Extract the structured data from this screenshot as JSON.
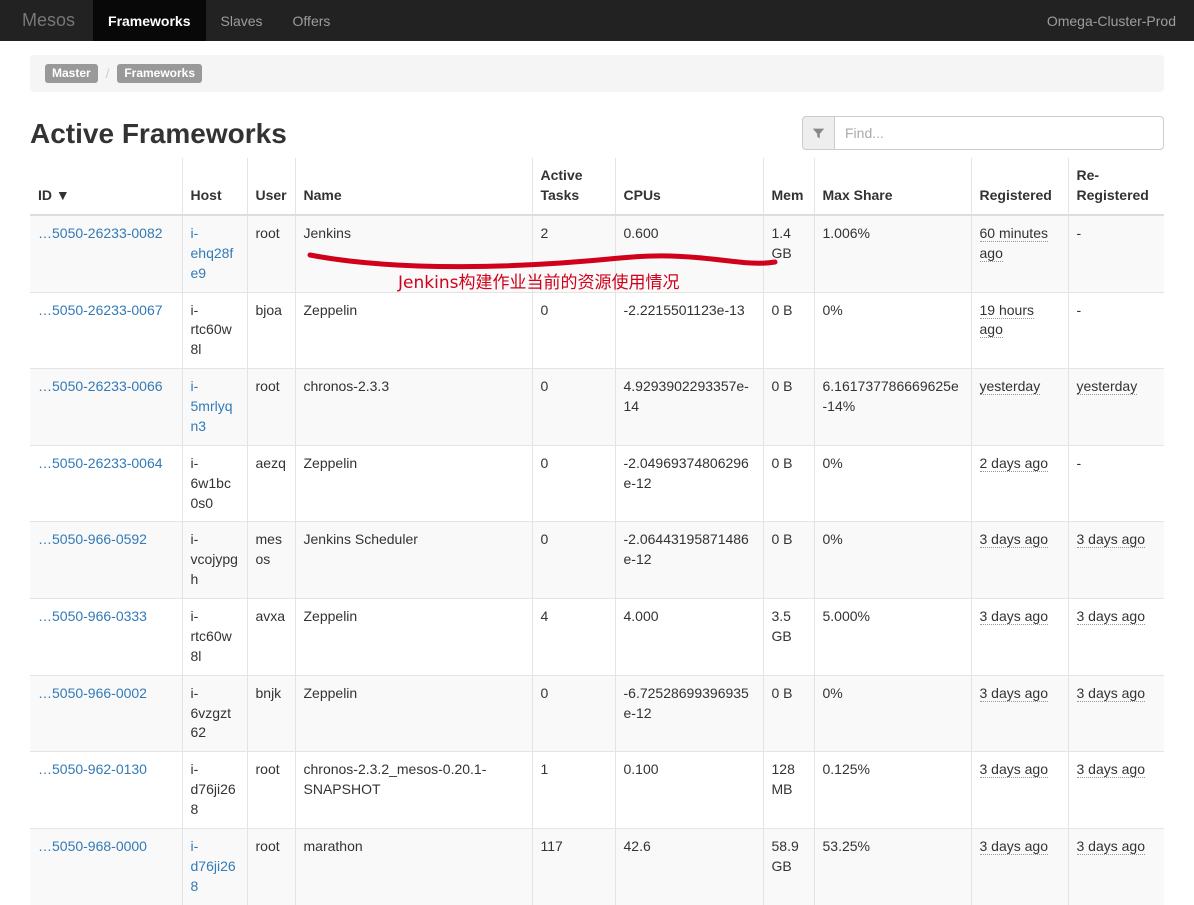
{
  "navbar": {
    "brand": "Mesos",
    "items": [
      {
        "label": "Frameworks",
        "active": true
      },
      {
        "label": "Slaves",
        "active": false
      },
      {
        "label": "Offers",
        "active": false
      }
    ],
    "cluster": "Omega-Cluster-Prod"
  },
  "breadcrumb": {
    "items": [
      "Master",
      "Frameworks"
    ],
    "separator": "/"
  },
  "page": {
    "title": "Active Frameworks"
  },
  "filter": {
    "icon": "funnel-icon",
    "placeholder": "Find...",
    "value": ""
  },
  "table": {
    "columns": [
      "ID",
      "Host",
      "User",
      "Name",
      "Active Tasks",
      "CPUs",
      "Mem",
      "Max Share",
      "Registered",
      "Re-Registered"
    ],
    "sort_column": "ID",
    "sort_indicator": "▼",
    "rows": [
      {
        "id": "…5050-26233-0082",
        "host": "i-ehq28fe9",
        "host_link": true,
        "user": "root",
        "name": "Jenkins",
        "active_tasks": "2",
        "cpus": "0.600",
        "mem": "1.4 GB",
        "max_share": "1.006%",
        "registered": "60 minutes ago",
        "re_registered": "-"
      },
      {
        "id": "…5050-26233-0067",
        "host": "i-rtc60w8l",
        "host_link": false,
        "user": "bjoa",
        "name": "Zeppelin",
        "active_tasks": "0",
        "cpus": "-2.2215501123e-13",
        "mem": "0 B",
        "max_share": "0%",
        "registered": "19 hours ago",
        "re_registered": "-"
      },
      {
        "id": "…5050-26233-0066",
        "host": "i-5mrlyqn3",
        "host_link": true,
        "user": "root",
        "name": "chronos-2.3.3",
        "active_tasks": "0",
        "cpus": "4.9293902293357e-14",
        "mem": "0 B",
        "max_share": "6.161737786669625e-14%",
        "registered": "yesterday",
        "re_registered": "yesterday"
      },
      {
        "id": "…5050-26233-0064",
        "host": "i-6w1bc0s0",
        "host_link": false,
        "user": "aezq",
        "name": "Zeppelin",
        "active_tasks": "0",
        "cpus": "-2.04969374806296e-12",
        "mem": "0 B",
        "max_share": "0%",
        "registered": "2 days ago",
        "re_registered": "-"
      },
      {
        "id": "…5050-966-0592",
        "host": "i-vcojypgh",
        "host_link": false,
        "user": "mesos",
        "name": "Jenkins Scheduler",
        "active_tasks": "0",
        "cpus": "-2.06443195871486e-12",
        "mem": "0 B",
        "max_share": "0%",
        "registered": "3 days ago",
        "re_registered": "3 days ago"
      },
      {
        "id": "…5050-966-0333",
        "host": "i-rtc60w8l",
        "host_link": false,
        "user": "avxa",
        "name": "Zeppelin",
        "active_tasks": "4",
        "cpus": "4.000",
        "mem": "3.5 GB",
        "max_share": "5.000%",
        "registered": "3 days ago",
        "re_registered": "3 days ago"
      },
      {
        "id": "…5050-966-0002",
        "host": "i-6vzgzt62",
        "host_link": false,
        "user": "bnjk",
        "name": "Zeppelin",
        "active_tasks": "0",
        "cpus": "-6.72528699396935e-12",
        "mem": "0 B",
        "max_share": "0%",
        "registered": "3 days ago",
        "re_registered": "3 days ago"
      },
      {
        "id": "…5050-962-0130",
        "host": "i-d76ji268",
        "host_link": false,
        "user": "root",
        "name": "chronos-2.3.2_mesos-0.20.1-SNAPSHOT",
        "active_tasks": "1",
        "cpus": "0.100",
        "mem": "128 MB",
        "max_share": "0.125%",
        "registered": "3 days ago",
        "re_registered": "3 days ago"
      },
      {
        "id": "…5050-968-0000",
        "host": "i-d76ji268",
        "host_link": true,
        "user": "root",
        "name": "marathon",
        "active_tasks": "117",
        "cpus": "42.6",
        "mem": "58.9 GB",
        "max_share": "53.25%",
        "registered": "3 days ago",
        "re_registered": "3 days ago"
      }
    ]
  },
  "annotation": {
    "text": "Jenkins构建作业当前的资源使用情况",
    "color": "#d0021b"
  }
}
